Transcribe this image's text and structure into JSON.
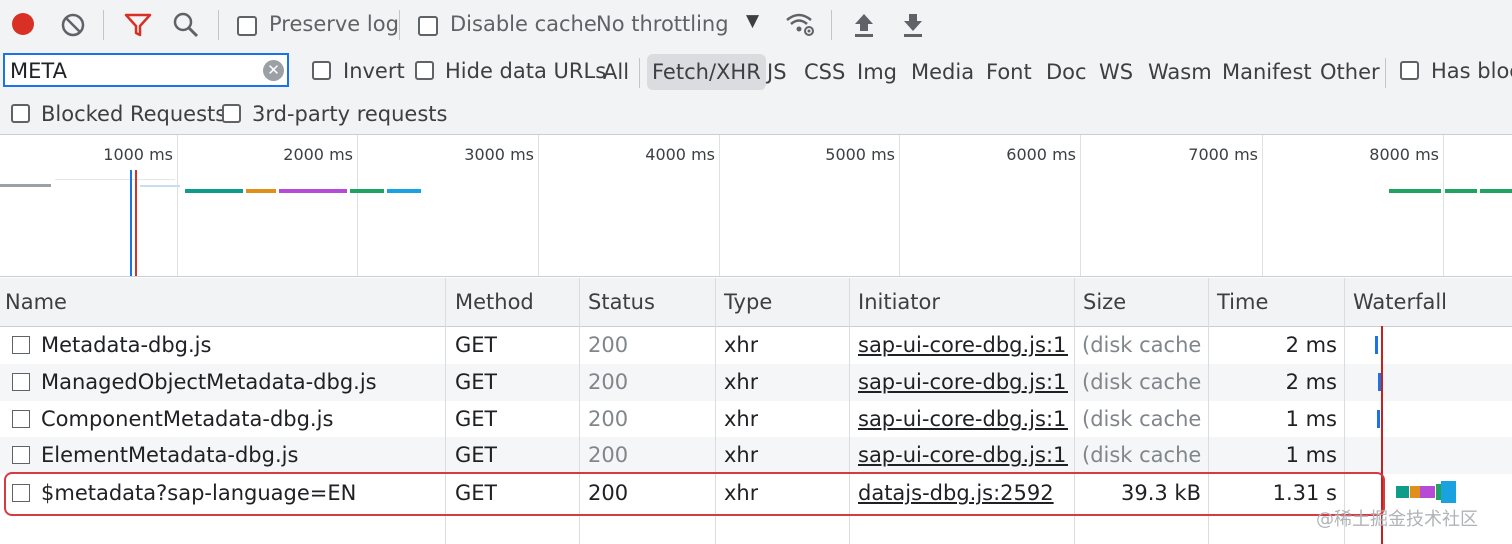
{
  "toolbar": {
    "preserve_log": "Preserve log",
    "disable_cache": "Disable cache",
    "throttling": "No throttling"
  },
  "filter": {
    "search_value": "META",
    "invert": "Invert",
    "hide_data_urls": "Hide data URLs",
    "types": [
      "All",
      "Fetch/XHR",
      "JS",
      "CSS",
      "Img",
      "Media",
      "Font",
      "Doc",
      "WS",
      "Wasm",
      "Manifest",
      "Other"
    ],
    "active_type": "Fetch/XHR",
    "has_blocked": "Has bloc",
    "blocked_requests": "Blocked Requests",
    "third_party": "3rd-party requests"
  },
  "overview": {
    "ticks": [
      "1000 ms",
      "2000 ms",
      "3000 ms",
      "4000 ms",
      "5000 ms",
      "6000 ms",
      "7000 ms",
      "8000 ms"
    ]
  },
  "columns": {
    "name": "Name",
    "method": "Method",
    "status": "Status",
    "type": "Type",
    "initiator": "Initiator",
    "size": "Size",
    "time": "Time",
    "waterfall": "Waterfall"
  },
  "rows": [
    {
      "name": "Metadata-dbg.js",
      "method": "GET",
      "status": "200",
      "type": "xhr",
      "initiator": "sap-ui-core-dbg.js:1...",
      "size": "(disk cache)",
      "time": "2 ms"
    },
    {
      "name": "ManagedObjectMetadata-dbg.js",
      "method": "GET",
      "status": "200",
      "type": "xhr",
      "initiator": "sap-ui-core-dbg.js:1...",
      "size": "(disk cache)",
      "time": "2 ms"
    },
    {
      "name": "ComponentMetadata-dbg.js",
      "method": "GET",
      "status": "200",
      "type": "xhr",
      "initiator": "sap-ui-core-dbg.js:1...",
      "size": "(disk cache)",
      "time": "1 ms"
    },
    {
      "name": "ElementMetadata-dbg.js",
      "method": "GET",
      "status": "200",
      "type": "xhr",
      "initiator": "sap-ui-core-dbg.js:1...",
      "size": "(disk cache)",
      "time": "1 ms"
    },
    {
      "name": "$metadata?sap-language=EN",
      "method": "GET",
      "status": "200",
      "type": "xhr",
      "initiator": "datajs-dbg.js:2592",
      "size": "39.3 kB",
      "time": "1.31 s"
    }
  ],
  "watermark": "@稀土掘金技术社区",
  "colors": {
    "record": "#d93025",
    "filter_active": "#d93025",
    "highlight": "#d93a40"
  }
}
